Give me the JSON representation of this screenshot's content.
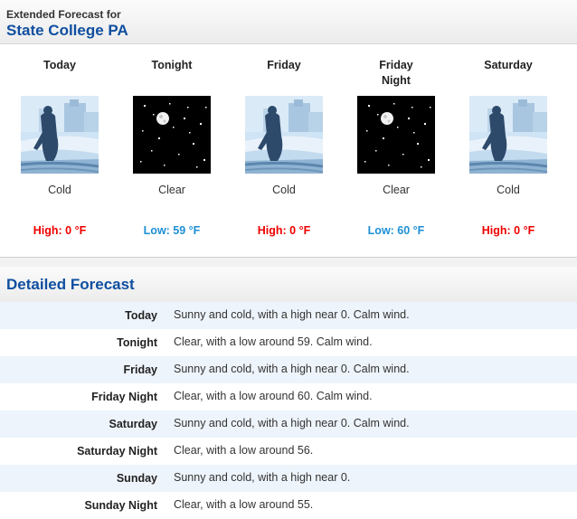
{
  "header": {
    "subtitle": "Extended Forecast for",
    "location": "State College PA"
  },
  "forecast": [
    {
      "period": "Today",
      "icon": "cold-icon",
      "condition": "Cold",
      "temp": "High: 0 °F",
      "kind": "high"
    },
    {
      "period": "Tonight",
      "icon": "clear-night-icon",
      "condition": "Clear",
      "temp": "Low: 59 °F",
      "kind": "low"
    },
    {
      "period": "Friday",
      "icon": "cold-icon",
      "condition": "Cold",
      "temp": "High: 0 °F",
      "kind": "high"
    },
    {
      "period": "Friday\nNight",
      "icon": "clear-night-icon",
      "condition": "Clear",
      "temp": "Low: 60 °F",
      "kind": "low"
    },
    {
      "period": "Saturday",
      "icon": "cold-icon",
      "condition": "Cold",
      "temp": "High: 0 °F",
      "kind": "high"
    }
  ],
  "detailed": {
    "title": "Detailed Forecast",
    "rows": [
      {
        "label": "Today",
        "text": "Sunny and cold, with a high near 0. Calm wind."
      },
      {
        "label": "Tonight",
        "text": "Clear, with a low around 59. Calm wind."
      },
      {
        "label": "Friday",
        "text": "Sunny and cold, with a high near 0. Calm wind."
      },
      {
        "label": "Friday Night",
        "text": "Clear, with a low around 60. Calm wind."
      },
      {
        "label": "Saturday",
        "text": "Sunny and cold, with a high near 0. Calm wind."
      },
      {
        "label": "Saturday Night",
        "text": "Clear, with a low around 56."
      },
      {
        "label": "Sunday",
        "text": "Sunny and cold, with a high near 0."
      },
      {
        "label": "Sunday Night",
        "text": "Clear, with a low around 55."
      }
    ]
  },
  "colors": {
    "high": "#ee0000",
    "low": "#1d8fd6",
    "heading": "#0f4fa0",
    "row_alt": "#eef4fb"
  }
}
